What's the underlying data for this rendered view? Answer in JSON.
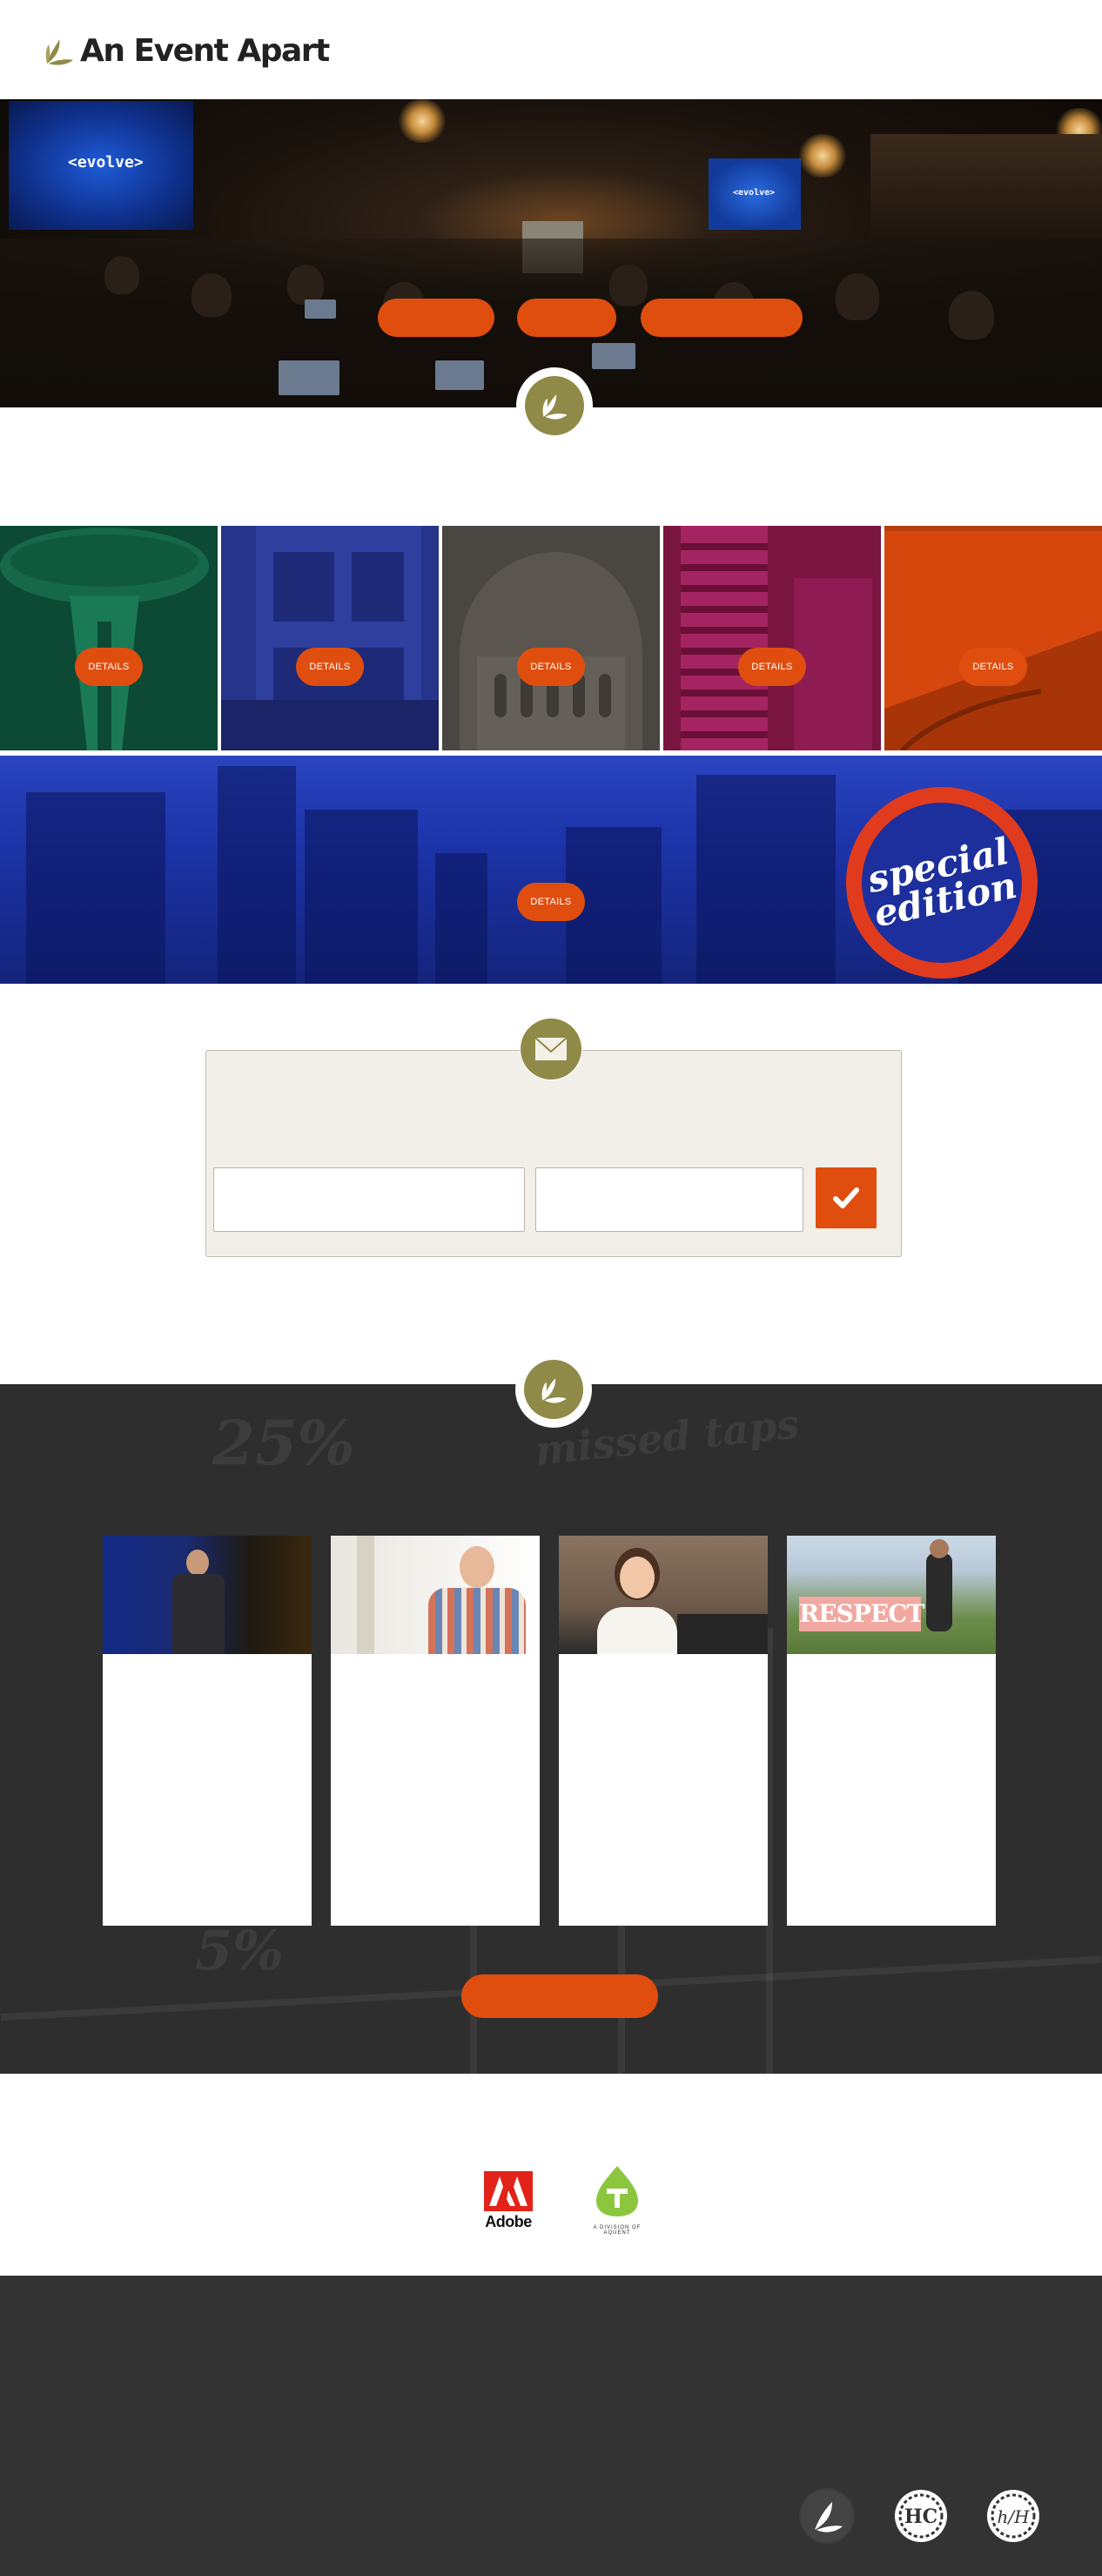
{
  "brand": {
    "name": "An Event Apart",
    "accent": "#e04e0f",
    "olive": "#8f8a47",
    "dark": "#2e2e2e"
  },
  "hero": {
    "screen_text_left": "<evolve>",
    "screen_text_right": "<evolve>",
    "buttons": [
      "",
      "",
      ""
    ]
  },
  "events": {
    "tiles": [
      {
        "city_color": "#0c4a35",
        "details_label": "DETAILS"
      },
      {
        "city_color": "#26348a",
        "details_label": "DETAILS"
      },
      {
        "city_color": "#4a4641",
        "details_label": "DETAILS"
      },
      {
        "city_color": "#7a1540",
        "details_label": "DETAILS"
      },
      {
        "city_color": "#d6470e",
        "details_label": "DETAILS"
      }
    ],
    "special": {
      "details_label": "DETAILS",
      "badge_line1": "special",
      "badge_line2": "edition"
    }
  },
  "newsletter": {
    "first_field_value": "",
    "second_field_value": "",
    "submit_icon": "checkmark-icon"
  },
  "speakers": {
    "background_words": [
      "25%",
      "missed taps",
      "5%"
    ],
    "cards": [
      {
        "photo": "speaker-photo-stage"
      },
      {
        "photo": "speaker-photo-plaid-shirt"
      },
      {
        "photo": "speaker-photo-woman"
      },
      {
        "photo": "speaker-photo-respect-sign",
        "sign_text": "RESPECT"
      }
    ],
    "more_button": ""
  },
  "sponsors": {
    "adobe": "Adobe",
    "aquent_tagline": "A DIVISION OF AQUENT"
  },
  "footer": {
    "icons": [
      "aea-leaf-icon",
      "hc-icon",
      "hh-icon"
    ],
    "hc_label": "HC",
    "hh_label": "h/H"
  }
}
